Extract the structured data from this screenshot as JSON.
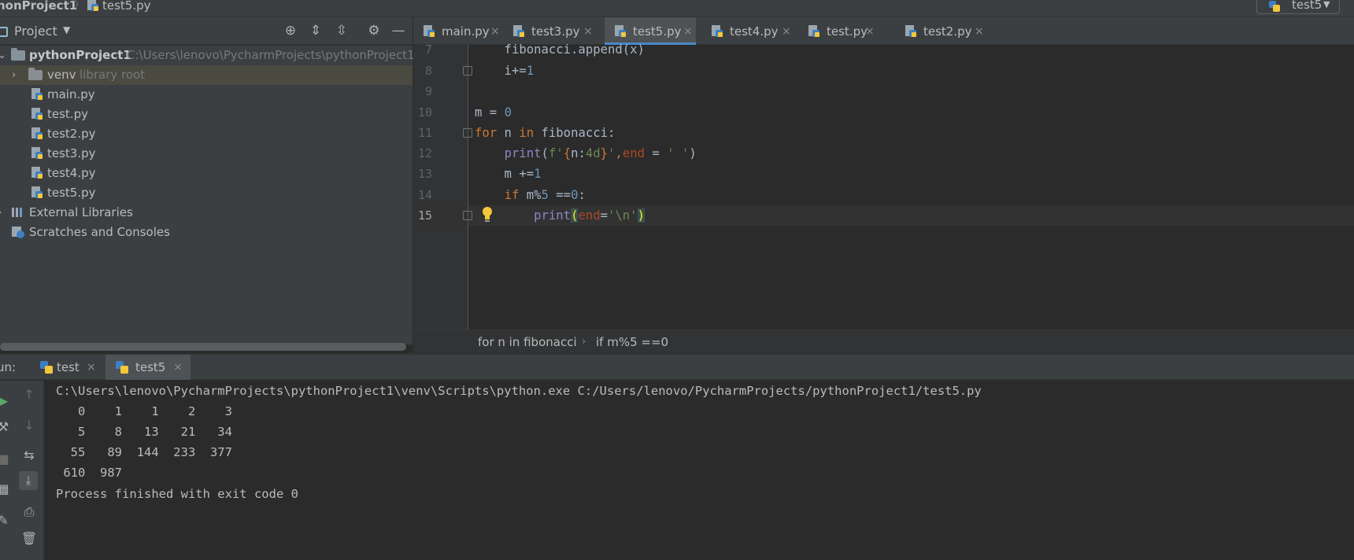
{
  "navbar": {
    "project": "honProject1",
    "separator": "〉",
    "file": "test5.py"
  },
  "run_config": {
    "label": "test5",
    "caret": "▼"
  },
  "project_panel": {
    "title": "Project",
    "caret": "▼",
    "toolbar_icons": [
      "locate-icon",
      "expand-all-icon",
      "collapse-all-icon",
      "gear-icon",
      "minimize-icon"
    ],
    "tree": [
      {
        "label": "pythonProject1",
        "hint": "C:\\Users\\lenovo\\PycharmProjects\\pythonProject1",
        "kind": "folder",
        "expanded": true
      },
      {
        "label": "venv",
        "hint": "library root",
        "kind": "folder",
        "expanded": false
      },
      {
        "label": "main.py",
        "kind": "python-file"
      },
      {
        "label": "test.py",
        "kind": "python-file"
      },
      {
        "label": "test2.py",
        "kind": "python-file"
      },
      {
        "label": "test3.py",
        "kind": "python-file"
      },
      {
        "label": "test4.py",
        "kind": "python-file"
      },
      {
        "label": "test5.py",
        "kind": "python-file"
      },
      {
        "label": "External Libraries",
        "kind": "libraries"
      },
      {
        "label": "Scratches and Consoles",
        "kind": "scratches"
      }
    ]
  },
  "editor": {
    "tabs": [
      {
        "label": "main.py",
        "active": false
      },
      {
        "label": "test3.py",
        "active": false
      },
      {
        "label": "test5.py",
        "active": true
      },
      {
        "label": "test4.py",
        "active": false
      },
      {
        "label": "test.py",
        "active": false
      },
      {
        "label": "test2.py",
        "active": false
      }
    ],
    "close_glyph": "×",
    "line_numbers": [
      "7",
      "8",
      "9",
      "10",
      "11",
      "12",
      "13",
      "14",
      "15"
    ],
    "current_line": "15",
    "breadcrumb": [
      "for n in fibonacci",
      "if m%5 ==0"
    ],
    "breadcrumb_sep": "›"
  },
  "run_panel": {
    "label": "un:",
    "tabs": [
      {
        "label": "test",
        "active": false
      },
      {
        "label": "test5",
        "active": true
      }
    ],
    "console": [
      "C:\\Users\\lenovo\\PycharmProjects\\pythonProject1\\venv\\Scripts\\python.exe C:/Users/lenovo/PycharmProjects/pythonProject1/test5.py",
      "   0    1    1    2    3",
      "   5    8   13   21   34",
      "  55   89  144  233  377",
      " 610  987",
      "Process finished with exit code 0"
    ]
  },
  "colors": {
    "accent": "#4a88c7",
    "keyword": "#cc7832",
    "number": "#6897bb",
    "string": "#6a8759",
    "builtin": "#8888c6",
    "param": "#aa4926"
  }
}
